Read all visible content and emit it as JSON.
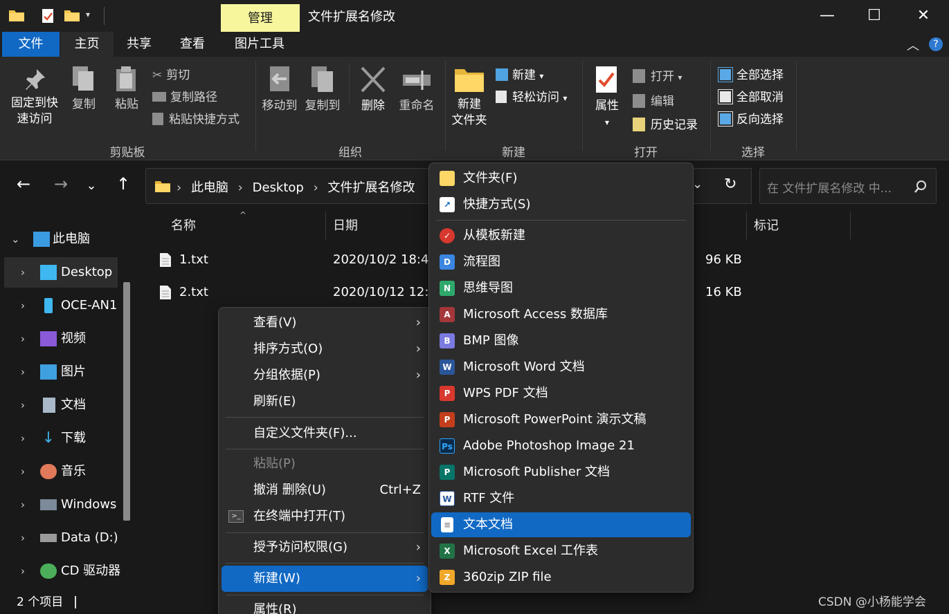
{
  "window": {
    "title": "文件扩展名修改",
    "context_tab": "管理",
    "minimize": "—",
    "maximize": "☐",
    "close": "✕"
  },
  "tabs": [
    {
      "label": "文件"
    },
    {
      "label": "主页"
    },
    {
      "label": "共享"
    },
    {
      "label": "查看"
    },
    {
      "label": "图片工具"
    }
  ],
  "ribbon": {
    "clipboard": {
      "label": "剪贴板",
      "pin": "固定到快",
      "pin2": "速访问",
      "copy": "复制",
      "paste": "粘贴",
      "cut": "剪切",
      "copy_path": "复制路径",
      "paste_shortcut": "粘贴快捷方式"
    },
    "organize": {
      "label": "组织",
      "move_to": "移动到",
      "copy_to": "复制到",
      "delete": "删除",
      "rename": "重命名"
    },
    "new": {
      "label": "新建",
      "new_folder": "新建",
      "new_folder2": "文件夹",
      "new_item": "新建",
      "easy_access": "轻松访问"
    },
    "open": {
      "label": "打开",
      "properties": "属性",
      "open": "打开",
      "edit": "编辑",
      "history": "历史记录"
    },
    "select": {
      "label": "选择",
      "select_all": "全部选择",
      "select_none": "全部取消",
      "invert": "反向选择"
    }
  },
  "address": {
    "path": [
      "此电脑",
      "Desktop",
      "文件扩展名修改"
    ],
    "search_placeholder": "在 文件扩展名修改 中..."
  },
  "sidebar": {
    "items": [
      {
        "label": "此电脑"
      },
      {
        "label": "Desktop"
      },
      {
        "label": "OCE-AN1"
      },
      {
        "label": "视频"
      },
      {
        "label": "图片"
      },
      {
        "label": "文档"
      },
      {
        "label": "下载"
      },
      {
        "label": "音乐"
      },
      {
        "label": "Windows"
      },
      {
        "label": "Data (D:)"
      },
      {
        "label": "CD 驱动器"
      }
    ]
  },
  "columns": {
    "name": "名称",
    "date": "日期",
    "tags": "标记"
  },
  "files": [
    {
      "name": "1.txt",
      "date": "2020/10/2 18:4",
      "size": "96 KB"
    },
    {
      "name": "2.txt",
      "date": "2020/10/12 12:",
      "size": "16 KB"
    }
  ],
  "status": {
    "count": "2 个项目"
  },
  "context_menu": {
    "view": "查看(V)",
    "sort": "排序方式(O)",
    "group": "分组依据(P)",
    "refresh": "刷新(E)",
    "customize": "自定义文件夹(F)...",
    "paste": "粘贴(P)",
    "undo": "撤消 删除(U)",
    "undo_shortcut": "Ctrl+Z",
    "terminal": "在终端中打开(T)",
    "grant": "授予访问权限(G)",
    "new": "新建(W)",
    "properties": "属性(R)"
  },
  "submenu": [
    {
      "label": "文件夹(F)",
      "icon": "folder-icon"
    },
    {
      "label": "快捷方式(S)",
      "icon": "shortcut-icon"
    },
    {
      "label": "从模板新建",
      "icon": "template-icon"
    },
    {
      "label": "流程图",
      "icon": "flowchart-icon"
    },
    {
      "label": "思维导图",
      "icon": "mindmap-icon"
    },
    {
      "label": "Microsoft Access 数据库",
      "icon": "access-icon"
    },
    {
      "label": "BMP 图像",
      "icon": "bmp-icon"
    },
    {
      "label": "Microsoft Word 文档",
      "icon": "word-icon"
    },
    {
      "label": "WPS PDF 文档",
      "icon": "pdf-icon"
    },
    {
      "label": "Microsoft PowerPoint 演示文稿",
      "icon": "powerpoint-icon"
    },
    {
      "label": "Adobe Photoshop Image 21",
      "icon": "photoshop-icon"
    },
    {
      "label": "Microsoft Publisher 文档",
      "icon": "publisher-icon"
    },
    {
      "label": "RTF 文件",
      "icon": "rtf-icon"
    },
    {
      "label": "文本文档",
      "icon": "text-document-icon"
    },
    {
      "label": "Microsoft Excel 工作表",
      "icon": "excel-icon"
    },
    {
      "label": "360zip ZIP file",
      "icon": "zip-icon"
    }
  ],
  "watermark": "CSDN @小杨能学会",
  "colors": {
    "accent": "#1169c4",
    "manage_tab": "#f7f69d",
    "background": "#191919",
    "ribbon": "#2b2b2b",
    "menu": "#2c2c2c"
  }
}
